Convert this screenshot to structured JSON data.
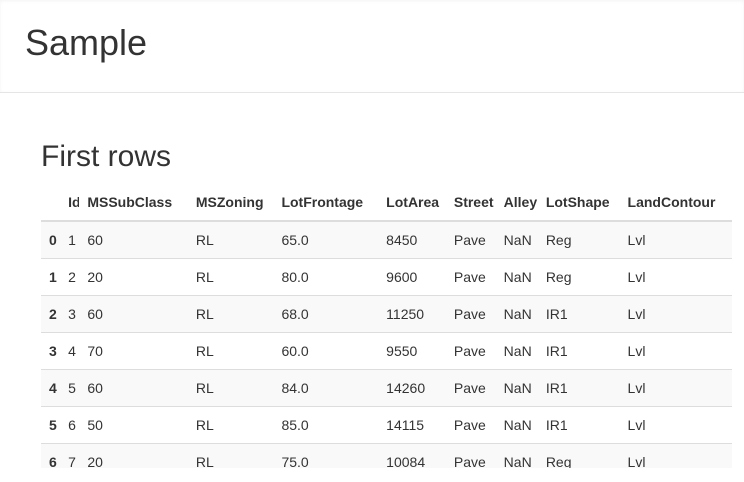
{
  "header": {
    "title": "Sample"
  },
  "section": {
    "title": "First rows"
  },
  "table": {
    "columns": [
      "",
      "Id",
      "MSSubClass",
      "MSZoning",
      "LotFrontage",
      "LotArea",
      "Street",
      "Alley",
      "LotShape",
      "LandContour"
    ],
    "rows": [
      {
        "index": "0",
        "cells": [
          "1",
          "60",
          "RL",
          "65.0",
          "8450",
          "Pave",
          "NaN",
          "Reg",
          "Lvl"
        ]
      },
      {
        "index": "1",
        "cells": [
          "2",
          "20",
          "RL",
          "80.0",
          "9600",
          "Pave",
          "NaN",
          "Reg",
          "Lvl"
        ]
      },
      {
        "index": "2",
        "cells": [
          "3",
          "60",
          "RL",
          "68.0",
          "11250",
          "Pave",
          "NaN",
          "IR1",
          "Lvl"
        ]
      },
      {
        "index": "3",
        "cells": [
          "4",
          "70",
          "RL",
          "60.0",
          "9550",
          "Pave",
          "NaN",
          "IR1",
          "Lvl"
        ]
      },
      {
        "index": "4",
        "cells": [
          "5",
          "60",
          "RL",
          "84.0",
          "14260",
          "Pave",
          "NaN",
          "IR1",
          "Lvl"
        ]
      },
      {
        "index": "5",
        "cells": [
          "6",
          "50",
          "RL",
          "85.0",
          "14115",
          "Pave",
          "NaN",
          "IR1",
          "Lvl"
        ]
      },
      {
        "index": "6",
        "cells": [
          "7",
          "20",
          "RL",
          "75.0",
          "10084",
          "Pave",
          "NaN",
          "Reg",
          "Lvl"
        ]
      }
    ]
  }
}
